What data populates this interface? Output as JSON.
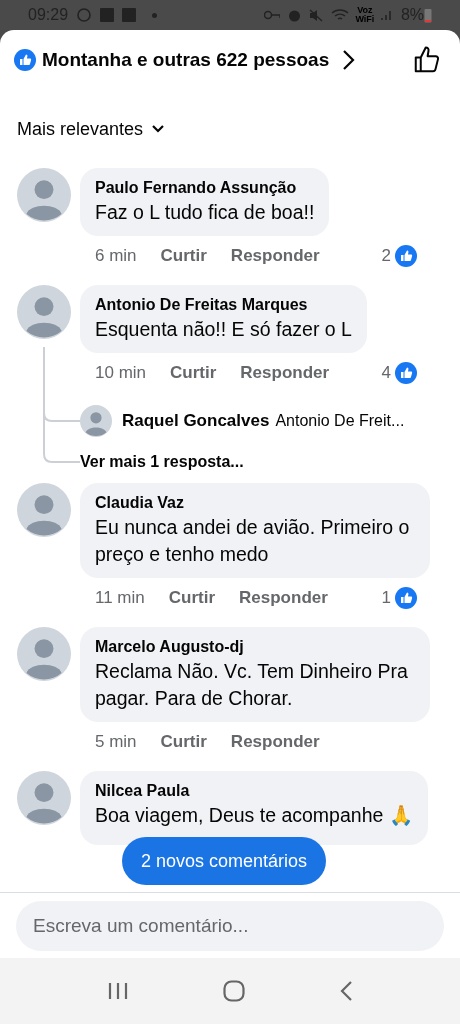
{
  "status_bar": {
    "time": "09:29",
    "wifi_label": "Voz WiFi",
    "battery": "8%"
  },
  "header": {
    "reactions": "Montanha e outras 622 pessoas"
  },
  "sort": {
    "label": "Mais relevantes"
  },
  "comments": [
    {
      "author": "Paulo Fernando Assunção",
      "text": "Faz o L tudo fica de boa!!",
      "time": "6 min",
      "like": "Curtir",
      "reply": "Responder",
      "likes": "2"
    },
    {
      "author": "Antonio De Freitas Marques",
      "text": "Esquenta não!! E só fazer  o L",
      "time": "10 min",
      "like": "Curtir",
      "reply": "Responder",
      "likes": "4",
      "replies": [
        {
          "author": "Raquel Goncalves",
          "text": "Antonio De Freit..."
        }
      ],
      "more_replies": "Ver mais 1 resposta..."
    },
    {
      "author": "Claudia Vaz",
      "text": "Eu nunca andei de avião. Primeiro o preço e tenho medo",
      "time": "11 min",
      "like": "Curtir",
      "reply": "Responder",
      "likes": "1"
    },
    {
      "author": "Marcelo Augusto-dj",
      "text": "Reclama Não. Vc. Tem Dinheiro Pra pagar. Para de Chorar.",
      "time": "5 min",
      "like": "Curtir",
      "reply": "Responder"
    },
    {
      "author": "Nilcea Paula",
      "text": "Boa viagem, Deus te acompanhe 🙏"
    }
  ],
  "new_comments_pill": "2 novos comentários",
  "composer": {
    "placeholder": "Escreva um comentário..."
  }
}
